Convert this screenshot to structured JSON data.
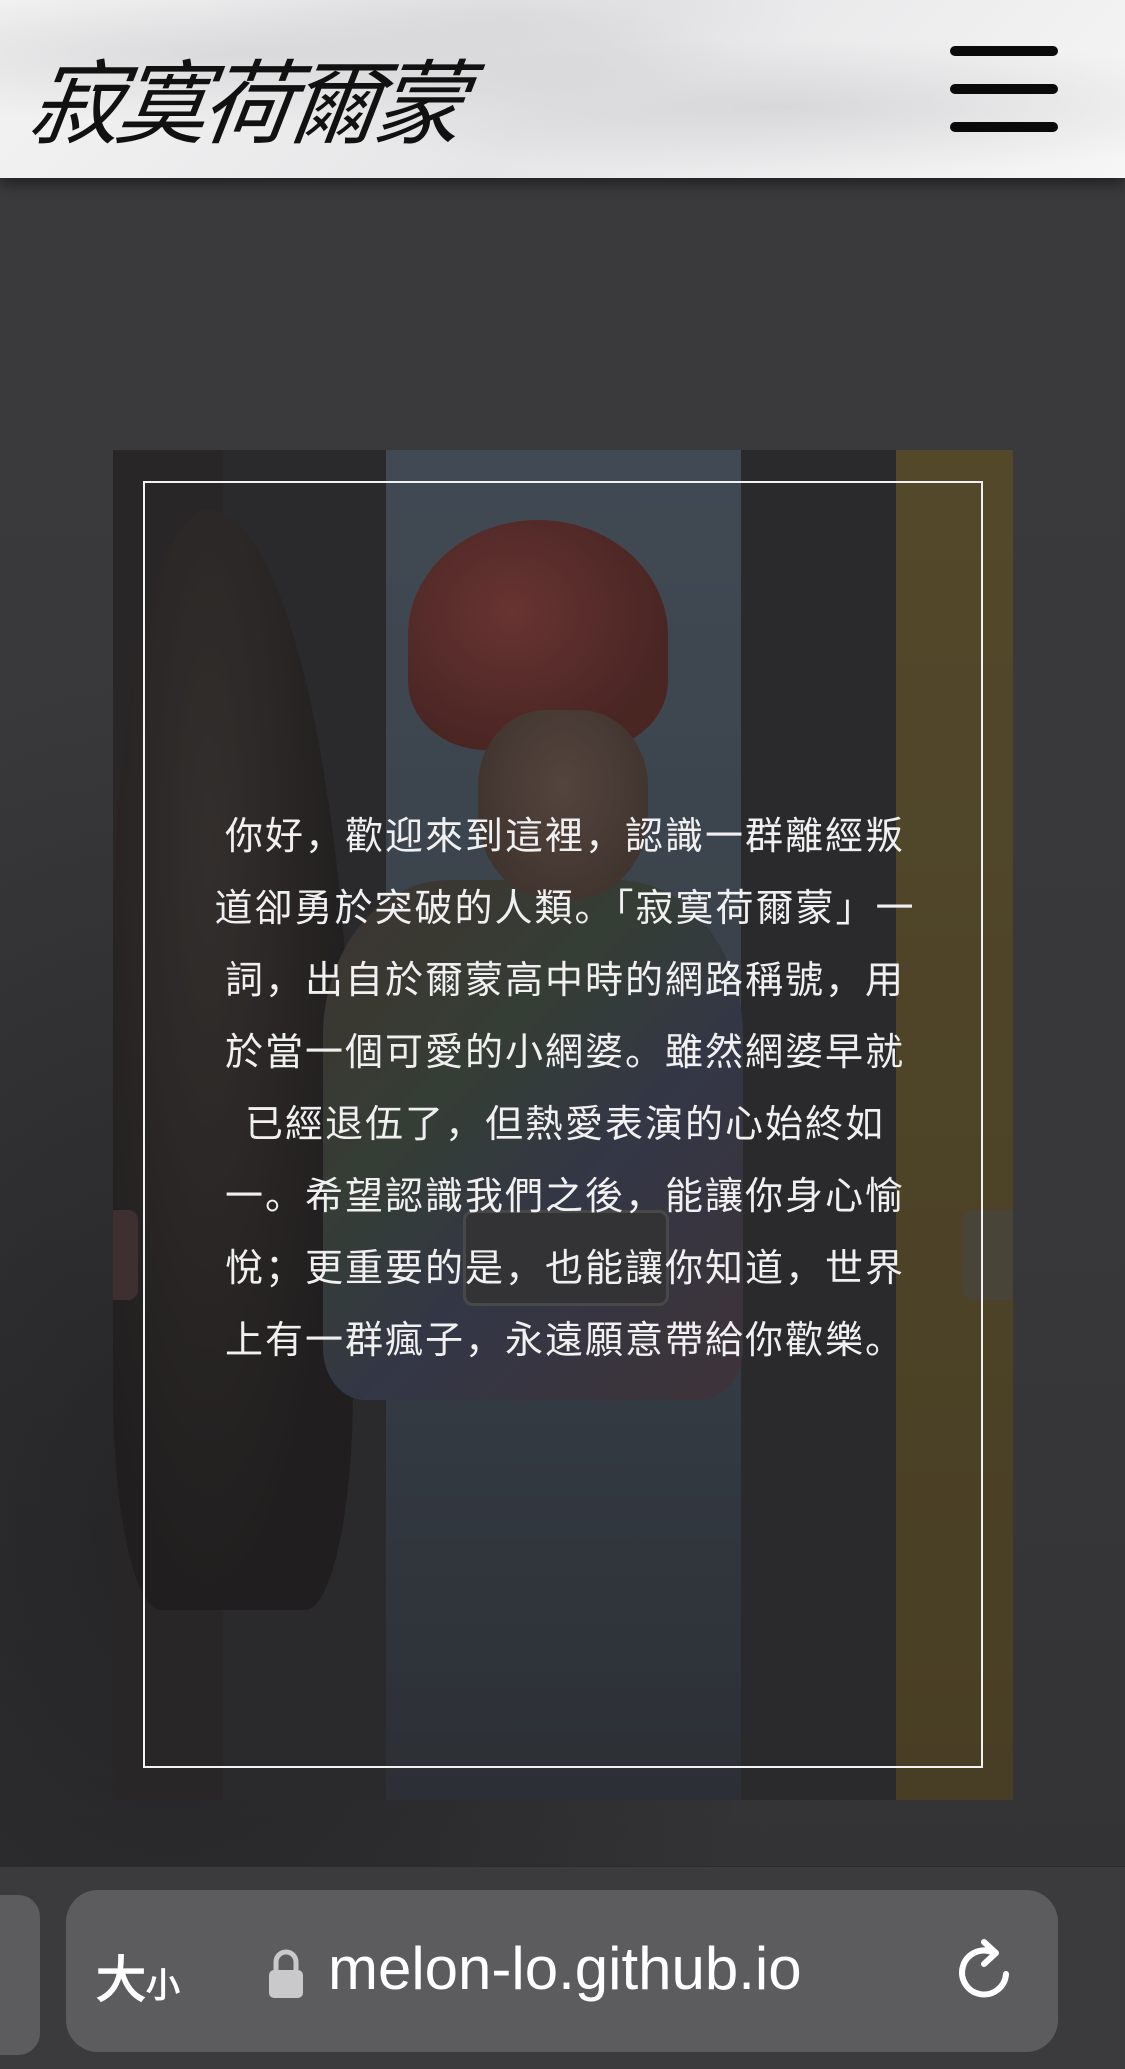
{
  "header": {
    "logo_text": "寂寞荷爾蒙",
    "menu_icon": "hamburger-menu-icon"
  },
  "intro": {
    "text": "你好，歡迎來到這裡，認識一群離經叛道卻勇於突破的人類。「寂寞荷爾蒙」一詞，出自於爾蒙高中時的網路稱號，用於當一個可愛的小網婆。雖然網婆早就已經退伍了，但熱愛表演的心始終如一。希望認識我們之後，能讓你身心愉悅；更重要的是，也能讓你知道，世界上有一群瘋子，永遠願意帶給你歡樂。"
  },
  "browser": {
    "text_size_big": "大",
    "text_size_small": "小",
    "url": "melon-lo.github.io",
    "lock_icon": "lock-icon",
    "reload_icon": "reload-icon"
  },
  "colors": {
    "overlay": "#3b3b3d",
    "frame": "#f2f2f2",
    "url_bar": "#5c5c5f"
  }
}
